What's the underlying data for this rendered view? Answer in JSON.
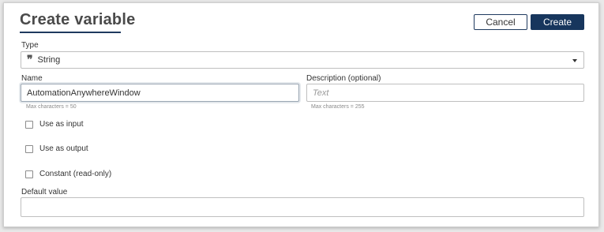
{
  "dialog": {
    "title": "Create variable",
    "cancel_label": "Cancel",
    "create_label": "Create"
  },
  "type_field": {
    "label": "Type",
    "icon": "quote-icon",
    "icon_glyph": "❞",
    "value": "String"
  },
  "name_field": {
    "label": "Name",
    "value": "AutomationAnywhereWindow",
    "hint": "Max characters = 50"
  },
  "description_field": {
    "label": "Description (optional)",
    "placeholder": "Text",
    "hint": "Max characters = 255"
  },
  "checkboxes": [
    {
      "label": "Use as input",
      "checked": false
    },
    {
      "label": "Use as output",
      "checked": false
    },
    {
      "label": "Constant (read-only)",
      "checked": false
    }
  ],
  "default_field": {
    "label": "Default value",
    "value": ""
  },
  "colors": {
    "primary": "#17365d",
    "border": "#bfbfbf"
  }
}
